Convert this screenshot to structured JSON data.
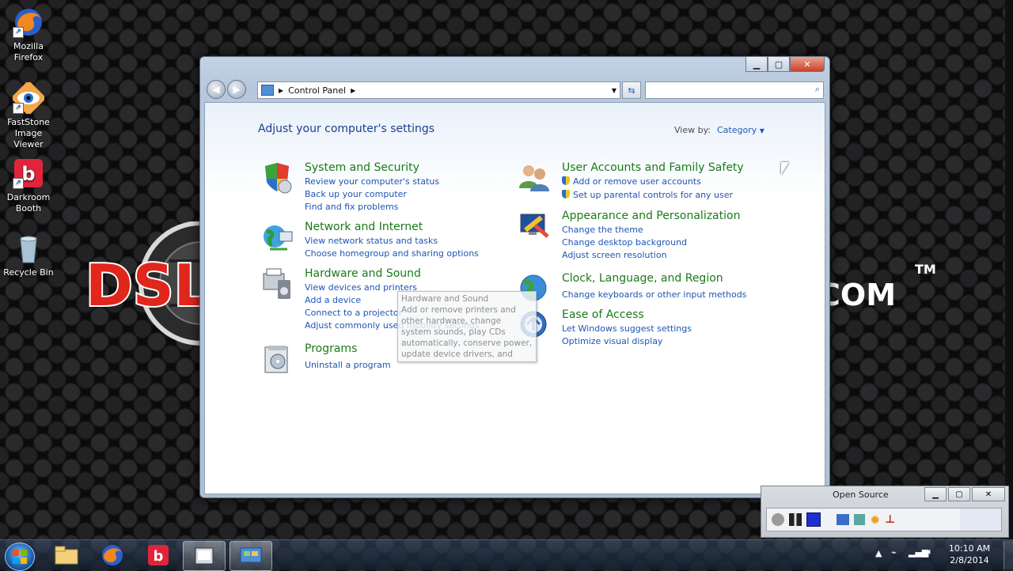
{
  "desktop": {
    "icons": [
      {
        "label": "Mozilla Firefox",
        "line1": "Mozilla",
        "line2": "Firefox"
      },
      {
        "label": "FastStone Image Viewer",
        "line1": "FastStone",
        "line2": "Image Viewer"
      },
      {
        "label": "Darkroom Booth",
        "line1": "Darkroom",
        "line2": "Booth"
      },
      {
        "label": "Recycle Bin",
        "line1": "Recycle Bin",
        "line2": ""
      }
    ],
    "logo_left": "DSL",
    "logo_right": "COM",
    "logo_mark": "TM"
  },
  "window": {
    "breadcrumb_root": "Control Panel",
    "search_placeholder": "",
    "heading": "Adjust your computer's settings",
    "view_by_label": "View by:",
    "view_by_value": "Category",
    "categories_left": [
      {
        "title": "System and Security",
        "links": [
          "Review your computer's status",
          "Back up your computer",
          "Find and fix problems"
        ]
      },
      {
        "title": "Network and Internet",
        "links": [
          "View network status and tasks",
          "Choose homegroup and sharing options"
        ]
      },
      {
        "title": "Hardware and Sound",
        "links": [
          "View devices and printers",
          "Add a device",
          "Connect to a projector",
          "Adjust commonly used mobility settings"
        ]
      },
      {
        "title": "Programs",
        "links": [
          "Uninstall a program"
        ]
      }
    ],
    "categories_right": [
      {
        "title": "User Accounts and Family Safety",
        "links": [
          "Add or remove user accounts",
          "Set up parental controls for any user"
        ]
      },
      {
        "title": "Appearance and Personalization",
        "links": [
          "Change the theme",
          "Change desktop background",
          "Adjust screen resolution"
        ]
      },
      {
        "title": "Clock, Language, and Region",
        "links": [
          "Change keyboards or other input methods"
        ]
      },
      {
        "title": "Ease of Access",
        "links": [
          "Let Windows suggest settings",
          "Optimize visual display"
        ]
      }
    ],
    "tooltip": {
      "title": "Hardware and Sound",
      "body": "Add or remove printers and other hardware, change system sounds, play CDs automatically, conserve power, update device drivers, and more."
    }
  },
  "mini_window": {
    "title": "Open Source"
  },
  "taskbar": {
    "items": [
      "Windows Explorer",
      "Firefox",
      "Darkroom Booth",
      "Recording app",
      "Control Panel"
    ],
    "clock_time": "10:10 AM",
    "clock_date": "2/8/2014"
  },
  "colors": {
    "link": "#1e55b4",
    "category_title": "#1a7a1a",
    "heading": "#1e3d8f"
  }
}
